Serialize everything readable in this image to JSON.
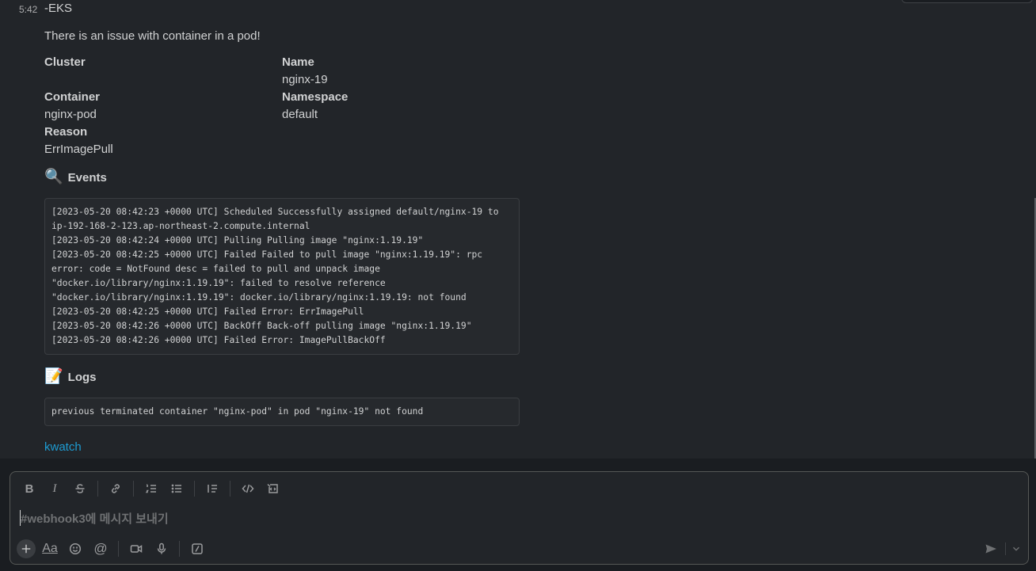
{
  "message": {
    "time": "5:42",
    "sender": "-EKS",
    "intro": "There is an issue with container in a pod!",
    "fields": {
      "cluster_label": "Cluster",
      "cluster_value": "",
      "name_label": "Name",
      "name_value": "nginx-19",
      "container_label": "Container",
      "container_value": "nginx-pod",
      "namespace_label": "Namespace",
      "namespace_value": "default",
      "reason_label": "Reason",
      "reason_value": "ErrImagePull"
    },
    "events_emoji": "🔍",
    "events_title": "Events",
    "events_text": "[2023-05-20 08:42:23 +0000 UTC] Scheduled Successfully assigned default/nginx-19 to ip-192-168-2-123.ap-northeast-2.compute.internal\n[2023-05-20 08:42:24 +0000 UTC] Pulling Pulling image \"nginx:1.19.19\"\n[2023-05-20 08:42:25 +0000 UTC] Failed Failed to pull image \"nginx:1.19.19\": rpc error: code = NotFound desc = failed to pull and unpack image \"docker.io/library/nginx:1.19.19\": failed to resolve reference \"docker.io/library/nginx:1.19.19\": docker.io/library/nginx:1.19.19: not found\n[2023-05-20 08:42:25 +0000 UTC] Failed Error: ErrImagePull\n[2023-05-20 08:42:26 +0000 UTC] BackOff Back-off pulling image \"nginx:1.19.19\"\n[2023-05-20 08:42:26 +0000 UTC] Failed Error: ImagePullBackOff",
    "logs_emoji": "📝",
    "logs_title": "Logs",
    "logs_text": "previous terminated container \"nginx-pod\" in pod \"nginx-19\" not found",
    "footer_link": "kwatch"
  },
  "composer": {
    "placeholder": "#webhook3에 메시지 보내기",
    "toolbar_top_icons": [
      "bold-icon",
      "italic-icon",
      "strikethrough-icon",
      "link-icon",
      "ordered-list-icon",
      "bulleted-list-icon",
      "blockquote-icon",
      "code-icon",
      "code-block-icon"
    ],
    "bold_glyph": "B",
    "italic_glyph": "I",
    "format_glyph": "Aa",
    "mention_glyph": "@"
  },
  "colors": {
    "link": "#1d9bd1",
    "background": "#1a1d21",
    "message_background": "#222529"
  }
}
